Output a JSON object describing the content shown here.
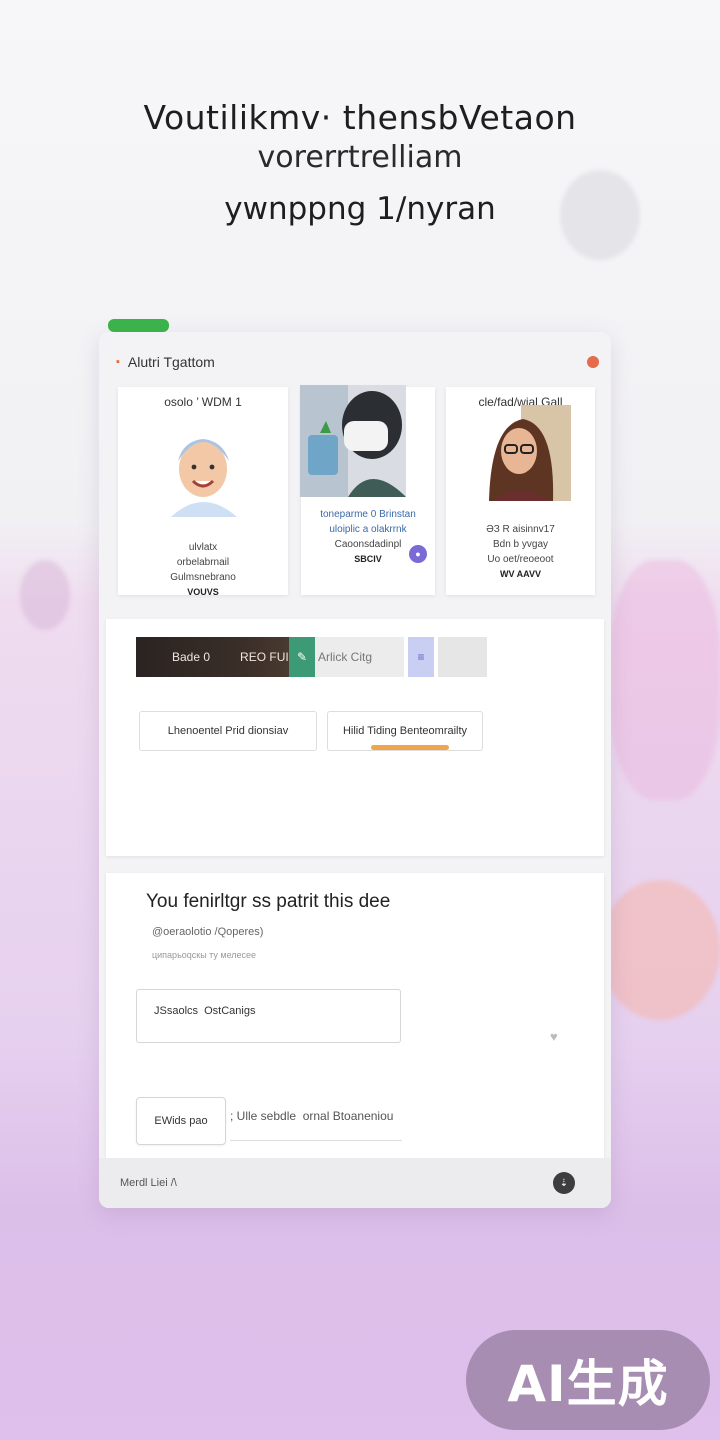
{
  "hero": {
    "line1": "Voutili⁠kmv· thensbVetaon",
    "line2": "vorerrtrelliam",
    "line3": "ywnppng 1/nyran"
  },
  "window": {
    "app_title": "Alutri Tgattom",
    "cards": [
      {
        "caption": "osolo ’ WDM 1",
        "lines": [
          "ulvlatx",
          "orbelabrnail",
          "Gulmsnebrano"
        ],
        "bold": "VOUVS"
      },
      {
        "caption": "",
        "lines": [
          "toneparme 0 Brinstan",
          "uloiplic a olakrrnk",
          "Caoonsdadinpl"
        ],
        "bold": "SBCIV"
      },
      {
        "caption": "cle/fad/wial Gall",
        "lines": [
          "ƏЗ R aisinnv17",
          "Bdn b yvgay",
          "Uo oet/reoeoot"
        ],
        "bold": "WV AAVV"
      }
    ],
    "toolbar": {
      "dark_left": "Bade 0",
      "dark_right": "REO FUI",
      "green_icon": "✎",
      "grey_label": "Arlick Citg",
      "blue_icon": "≡"
    },
    "tabs": {
      "left": "Lhenoentel Prid dionsiav",
      "right": "Hilid Tiding Benteomrailty"
    },
    "form": {
      "heading": "You fenirltgr ss patrit this dee",
      "sub1": "@oeraolotio /Qoperes)",
      "sub2": "ципарьоqскы ту мелесее",
      "field_value": "JSsaolcs ‌ OstCanigs",
      "small_button": "EWids pao",
      "helper": "; Ulle sebdle ‌ ornal Btoaneniou"
    },
    "footer": {
      "label": "Merdl Liei /\\",
      "button_icon": "⇣"
    }
  },
  "badge": {
    "text": "AI生成"
  },
  "colors": {
    "green_accent": "#3ab54a",
    "close_dot": "#e56b4d",
    "tab_accent": "#f0a54a",
    "toolbar_green": "#3c9a76"
  }
}
